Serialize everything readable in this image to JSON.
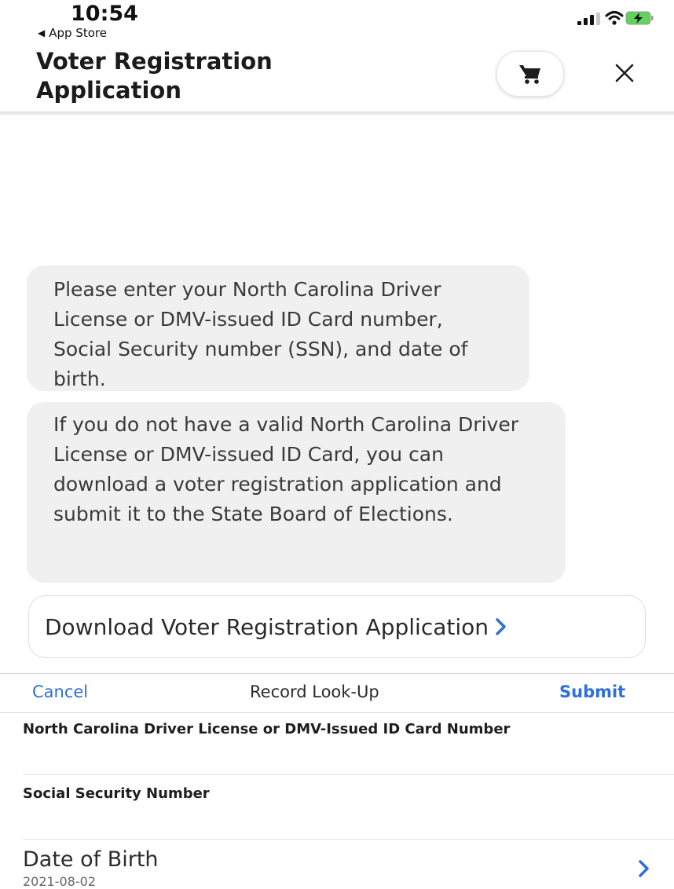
{
  "status_bar": {
    "time": "10:54",
    "back_app": "App Store",
    "signal_icon": "cellular-signal-icon",
    "wifi_icon": "wifi-icon",
    "battery_icon": "battery-charging-icon"
  },
  "header": {
    "title": "Voter Registration Application",
    "cart_icon": "shopping-cart-icon",
    "close_icon": "close-icon"
  },
  "messages": [
    {
      "text": "Please enter your North Carolina Driver License or DMV-issued ID Card number, Social Security number (SSN), and date of birth."
    },
    {
      "text": "If you do not have a valid North Carolina Driver License or DMV-issued ID Card, you can download a voter registration application and submit it to the State Board of Elections."
    }
  ],
  "download_button": {
    "label": "Download Voter Registration Application"
  },
  "form_toolbar": {
    "cancel_label": "Cancel",
    "title": "Record Look-Up",
    "submit_label": "Submit"
  },
  "fields": {
    "license": {
      "label": "North Carolina Driver License or DMV-Issued ID Card Number",
      "value": ""
    },
    "ssn": {
      "label": "Social Security Number",
      "value": ""
    },
    "dob": {
      "label": "Date of Birth",
      "value": "2021-08-02"
    }
  },
  "colors": {
    "accent": "#2f6fdb",
    "bubble_bg": "#f0f0f0",
    "battery": "#5fd35b"
  }
}
